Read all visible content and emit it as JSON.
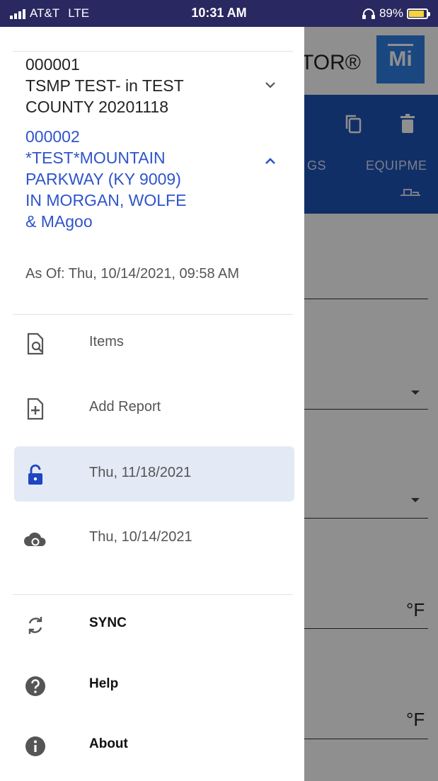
{
  "status_bar": {
    "carrier": "AT&T",
    "network": "LTE",
    "time": "10:31 AM",
    "battery": "89%",
    "battery_level": 0.89
  },
  "app": {
    "title_fragment": "TOR®",
    "logo_text": "Mi",
    "tabs": [
      "GS",
      "EQUIPME"
    ],
    "units": [
      "°F",
      "°F"
    ]
  },
  "drawer": {
    "projects": [
      {
        "lines": [
          "000001",
          "TSMP TEST- in TEST",
          "COUNTY 20201118"
        ],
        "expanded": false
      },
      {
        "lines": [
          "000002",
          "*TEST*MOUNTAIN",
          "PARKWAY (KY 9009)",
          "IN MORGAN, WOLFE",
          "& MAgoo"
        ],
        "expanded": true
      }
    ],
    "as_of": "As Of: Thu, 10/14/2021, 09:58 AM",
    "items": [
      {
        "label": "Items",
        "icon": "document-search-icon"
      },
      {
        "label": "Add Report",
        "icon": "add-document-icon"
      },
      {
        "label": "Thu, 11/18/2021",
        "icon": "lock-open-icon",
        "active": true
      },
      {
        "label": "Thu, 10/14/2021",
        "icon": "cloud-sync-icon"
      }
    ],
    "actions": [
      {
        "label": "SYNC",
        "icon": "sync-icon"
      },
      {
        "label": "Help",
        "icon": "help-icon"
      },
      {
        "label": "About",
        "icon": "info-icon"
      }
    ]
  },
  "colors": {
    "status_bar": "#2a2860",
    "accent_blue": "#2f54c9",
    "toolbar_blue": "#1f55b8",
    "active_item_bg": "#e3e9f5",
    "battery_yellow": "#f4d33c"
  }
}
